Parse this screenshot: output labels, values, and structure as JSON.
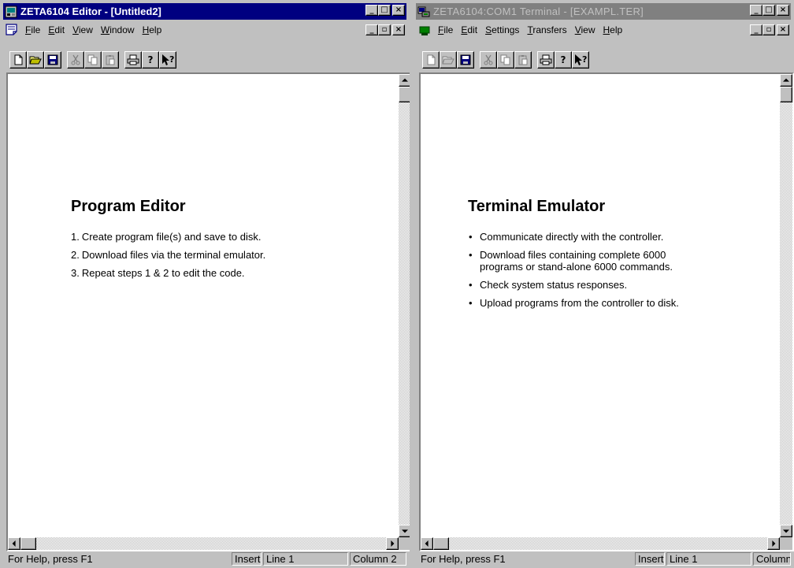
{
  "editor": {
    "title": "ZETA6104 Editor - [Untitled2]",
    "menu": [
      "File",
      "Edit",
      "View",
      "Window",
      "Help"
    ],
    "toolbar": [
      "new",
      "open",
      "save",
      "cut",
      "copy",
      "paste",
      "print",
      "help",
      "context-help"
    ],
    "heading": "Program Editor",
    "list_numbers": [
      "1.",
      "2.",
      "3."
    ],
    "items": [
      "Create program file(s) and save to disk.",
      "Download files via the terminal emulator.",
      "Repeat steps 1 & 2 to edit the code."
    ],
    "status": {
      "help": "For Help, press F1",
      "mode": "Insert",
      "line": "Line 1",
      "column": "Column 2"
    }
  },
  "terminal": {
    "title": "ZETA6104:COM1 Terminal - [EXAMPL.TER]",
    "menu": [
      "File",
      "Edit",
      "Settings",
      "Transfers",
      "View",
      "Help"
    ],
    "heading": "Terminal Emulator",
    "items": [
      "Communicate directly with the controller.",
      "Download files containing complete 6000",
      "programs or stand-alone 6000 commands.",
      "Check system status responses.",
      "Upload programs from the controller to disk."
    ],
    "status": {
      "help": "For Help, press F1",
      "mode": "Insert",
      "line": "Line 1",
      "column": "Column"
    }
  },
  "glyphs": {
    "minimize": "_",
    "maximize": "□",
    "restore": "▫",
    "close": "×",
    "help": "?",
    "context_help": "?"
  },
  "colors": {
    "active_title": "#000080",
    "inactive_title": "#808080",
    "face": "#c0c0c0"
  }
}
